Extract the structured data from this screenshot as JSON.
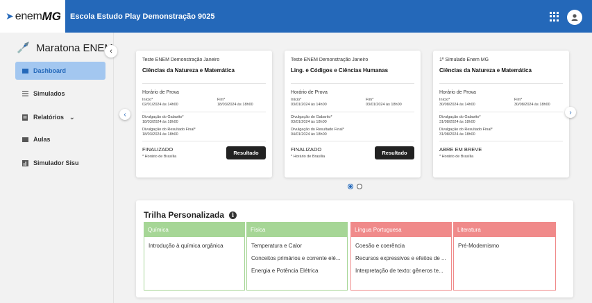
{
  "header": {
    "logo_text": "enem",
    "logo_bold": "MG",
    "school_name": "Escola Estudo Play Demonstração 9025"
  },
  "sidebar": {
    "title": "Maratona ENEM",
    "items": [
      {
        "label": "Dashboard",
        "active": true
      },
      {
        "label": "Simulados"
      },
      {
        "label": "Relatórios"
      },
      {
        "label": "Aulas"
      },
      {
        "label": "Simulador Sisu"
      }
    ]
  },
  "cards": [
    {
      "subtitle": "Teste ENEM Demonstração Janeiro",
      "title": "Ciências da Natureza e Matemática",
      "horario_label": "Horário de Prova",
      "inicio_label": "Início*",
      "inicio": "02/01/2024 às 14h00",
      "fim_label": "Fim*",
      "fim": "18/03/2024 às 18h00",
      "gabarito_label": "Divulgação do Gabarito*",
      "gabarito": "18/03/2024 às 18h00",
      "resultado_label": "Divulgação do Resultado Final*",
      "resultado": "18/03/2024 às 18h00",
      "status": "FINALIZADO",
      "timezone": "* Horário de Brasília",
      "button": "Resultado"
    },
    {
      "subtitle": "Teste ENEM Demonstração Janeiro",
      "title": "Ling. e Códigos e Ciências Humanas",
      "horario_label": "Horário de Prova",
      "inicio_label": "Início*",
      "inicio": "03/01/2024 às 14h00",
      "fim_label": "Fim*",
      "fim": "03/01/2024 às 18h00",
      "gabarito_label": "Divulgação do Gabarito*",
      "gabarito": "03/01/2024 às 18h00",
      "resultado_label": "Divulgação do Resultado Final*",
      "resultado": "04/01/2024 às 18h00",
      "status": "FINALIZADO",
      "timezone": "* Horário de Brasília",
      "button": "Resultado"
    },
    {
      "subtitle": "1º Simulado Enem MG",
      "title": "Ciências da Natureza e Matemática",
      "horario_label": "Horário de Prova",
      "inicio_label": "Início*",
      "inicio": "30/08/2024 às 14h00",
      "fim_label": "Fim*",
      "fim": "30/08/2024 às 18h00",
      "gabarito_label": "Divulgação do Gabarito*",
      "gabarito": "31/08/2024 às 18h00",
      "resultado_label": "Divulgação do Resultado Final*",
      "resultado": "31/08/2024 às 18h00",
      "status": "ABRE EM BREVE",
      "timezone": "* Horário de Brasília"
    }
  ],
  "trilha": {
    "title": "Trilha Personalizada",
    "columns": [
      {
        "header": "Química",
        "color": "#a6d696",
        "items": [
          "Introdução à química orgânica"
        ]
      },
      {
        "header": "Física",
        "color": "#a6d696",
        "items": [
          "Temperatura e Calor",
          "Conceitos primários e corrente elé...",
          "Energia e Potência Elétrica"
        ]
      },
      {
        "header": "Língua Portuguesa",
        "color": "#f08a8a",
        "items": [
          "Coesão e coerência",
          "Recursos expressivos e efeitos de ...",
          "Interpretação de texto: gêneros te..."
        ]
      },
      {
        "header": "Literatura",
        "color": "#f08a8a",
        "items": [
          "Pré-Modernismo"
        ]
      }
    ]
  },
  "colors": {
    "primary": "#2468b9",
    "active_nav": "#a3c7f0"
  }
}
